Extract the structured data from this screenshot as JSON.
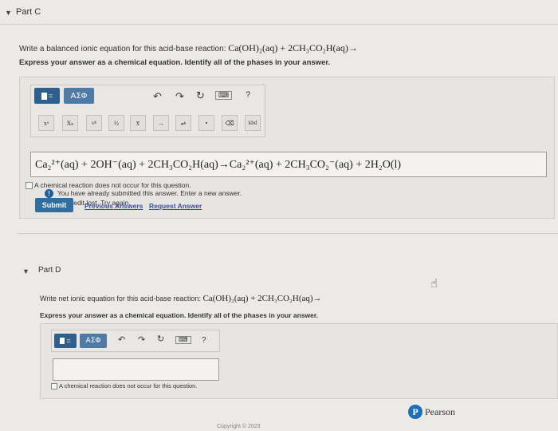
{
  "partC": {
    "caret": "▼",
    "title": "Part C",
    "question_prefix": "Write a balanced ionic equation for this acid-base reaction:",
    "question_formula": "Ca(OH)₂(aq) + 2CH₃CO₂H(aq)→",
    "instructions": "Express your answer as a chemical equation. Identify all of the phases in your answer.",
    "toolbar": {
      "greek_label": "ΑΣΦ",
      "help_label": "?",
      "symbols": [
        "xᵃ",
        "Xₕ",
        "ᵃ⁄ᵇ",
        "½",
        "x̅",
        "→",
        "⇌",
        "•",
        "⌫",
        "kbd"
      ]
    },
    "answer_value": "Ca₂²⁺(aq) + 2OH⁻(aq) + 2CH₃CO₂H(aq)→Ca₂²⁺(aq) + 2CH₃CO₂⁻(aq) + 2H₂O(l)",
    "no_reaction_label": "A chemical reaction does not occur for this question.",
    "feedback_line1": "You have already submitted this answer. Enter a new answer.",
    "feedback_line2": "No credit lost. Try again.",
    "submit_label": "Submit",
    "previous_answers_label": "Previous Answers",
    "request_answer_label": "Request Answer"
  },
  "partD": {
    "caret": "▼",
    "title": "Part D",
    "question_prefix": "Write net ionic equation for this acid-base reaction:",
    "question_formula": "Ca(OH)₂(aq) + 2CH₃CO₂H(aq)→",
    "instructions": "Express your answer as a chemical equation. Identify all of the phases in your answer.",
    "toolbar": {
      "greek_label": "ΑΣΦ",
      "help_label": "?"
    },
    "answer_value": "",
    "no_reaction_label": "A chemical reaction does not occur for this question."
  },
  "footer": {
    "brand": "Pearson",
    "logo_letter": "P",
    "copyright": "Copyright © 2023"
  },
  "icons": {
    "cursor": "hand-pointer-icon",
    "info": "info-icon"
  },
  "colors": {
    "accent": "#2f6e9e",
    "template_button": "#2f5f8d",
    "link": "#2a57a0"
  }
}
